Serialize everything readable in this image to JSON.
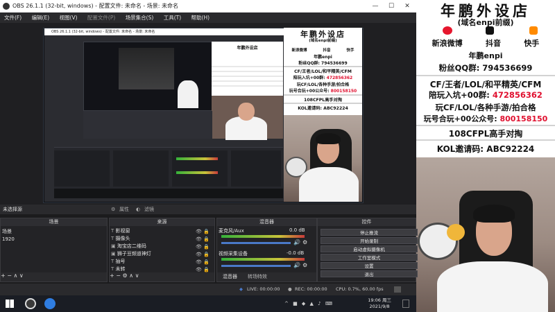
{
  "window": {
    "title": "OBS 26.1.1 (32-bit, windows) - 配置文件: 未命名 - 场景: 未命名",
    "minimize": "—",
    "maximize": "☐",
    "close": "✕"
  },
  "menu": [
    "文件(F)",
    "编辑(E)",
    "视图(V)",
    "配置文件(P)",
    "场景集合(S)",
    "工具(T)",
    "帮助(H)"
  ],
  "preview": {
    "nested_title": "OBS 26.1.1 (32-bit, windows) - 配置文件: 未命名 - 场景: 未命名"
  },
  "promo": {
    "store_name": "年鹏外设店",
    "domain_line": "(域名enpi前缀)",
    "platforms": [
      "新浪微博",
      "抖音",
      "快手"
    ],
    "handle": "年鹏enpi",
    "fan_group": "粉丝QQ群: 794536699",
    "line1": "CF/王者/LOL/和平精英/CFM",
    "line2_label": "陪玩入坑+00群: ",
    "line2_value": "472856362",
    "line3": "玩CF/LOL/各种手游/拍合格",
    "line4_label": "玩号合玩+00公众号: ",
    "line4_value": "800158150",
    "line5": "108CFPL高手对掏",
    "invite_label": "KOL邀请码: ",
    "invite_code": "ABC92224"
  },
  "source_bar": {
    "no_source": "未选择源",
    "properties": "属性",
    "filters": "滤镜"
  },
  "scenes": {
    "header": "场景",
    "items": [
      "场景",
      "1920"
    ],
    "footer": "+  −  ∧  ∨"
  },
  "sources": {
    "header": "来源",
    "items": [
      "影视窗",
      "摄像头",
      "淘宝店二维码",
      "狮子豆频道神灯",
      "抽号",
      "未转"
    ],
    "footer": "+  −  ⚙  ∧  ∨"
  },
  "mixer": {
    "header": "混音器",
    "track1_name": "麦克风/Aux",
    "track1_db": "0.0 dB",
    "track2_name": "视频采集设备",
    "track2_db": "-0.0 dB",
    "tab_mixer": "混音器",
    "tab_transitions": "转场特效"
  },
  "controls": {
    "header": "控件",
    "buttons": [
      "停止推流",
      "开始录制",
      "启动虚拟摄像机",
      "工作室模式",
      "设置",
      "退出"
    ]
  },
  "status": {
    "live": "LIVE: 00:00:00",
    "rec": "REC: 00:00:00",
    "cpu": "CPU: 0.7%, 60.00 fps"
  },
  "taskbar": {
    "time": "19:06 周三",
    "date": "2021/9/8"
  },
  "colors": {
    "accent_red": "#e0102f",
    "obs_bg": "#2a2a2d",
    "promo_bg": "#ffffff"
  }
}
